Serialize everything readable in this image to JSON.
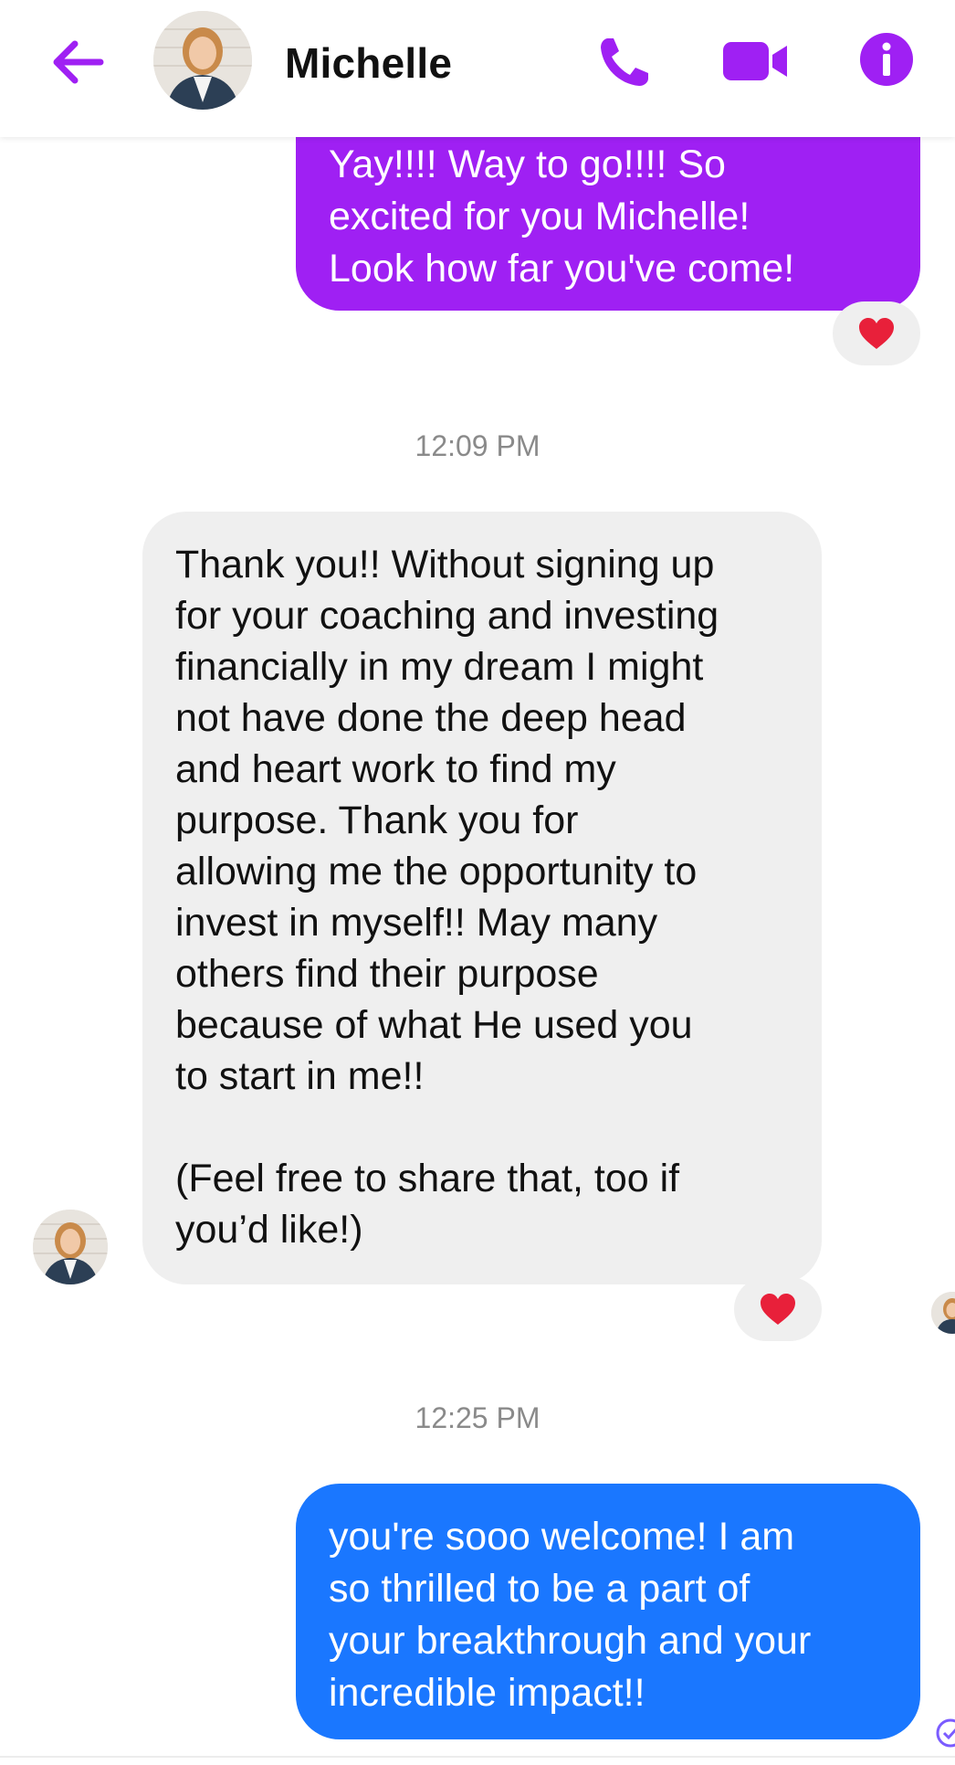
{
  "header": {
    "contact_name": "Michelle",
    "accent_color": "#9f20f3",
    "icons": [
      "back-arrow-icon",
      "phone-icon",
      "video-camera-icon",
      "info-icon"
    ]
  },
  "messages": [
    {
      "sender": "me",
      "text": "Yay!!!! Way to go!!!! So\nexcited for you Michelle!\nLook how far you've come!",
      "color": "#9f20f3",
      "reaction": "heart"
    },
    {
      "timestamp": "12:09 PM"
    },
    {
      "sender": "Michelle",
      "text": "Thank you!! Without signing up\nfor your coaching and investing\nfinancially in my dream I might\nnot have done the deep head\nand heart work to find my\npurpose. Thank you for\nallowing me the opportunity to\ninvest in myself!! May many\nothers find their purpose\nbecause of what He used you\nto start in me!!\n\n(Feel free to share that, too if\nyou’d like!)",
      "color": "#efefef",
      "reaction": "heart"
    },
    {
      "timestamp": "12:25 PM"
    },
    {
      "sender": "me",
      "text": "you're sooo welcome! I am\nso thrilled to be a part of\nyour breakthrough and your\nincredible impact!!",
      "color": "#1a77ff"
    }
  ]
}
